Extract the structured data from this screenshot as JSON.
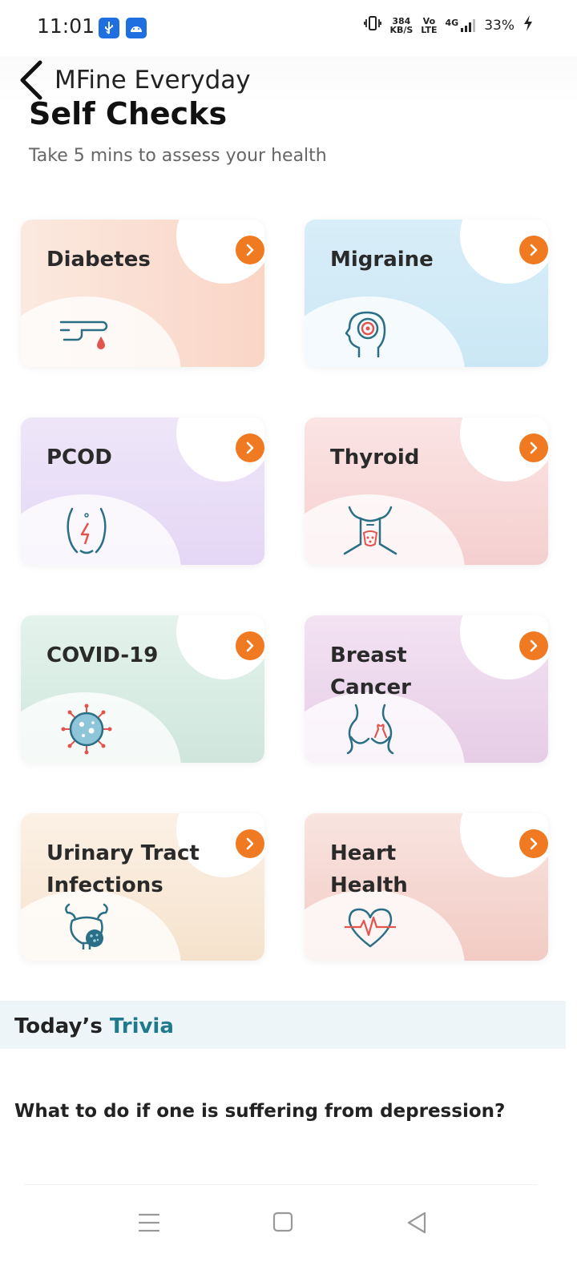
{
  "status": {
    "time": "11:01",
    "net_speed_value": "384",
    "net_speed_unit": "KB/S",
    "volte_top": "Vo",
    "volte_bottom": "LTE",
    "network": "4G",
    "battery": "33%"
  },
  "header": {
    "title": "MFine Everyday"
  },
  "page": {
    "title": "Self Checks",
    "subtitle": "Take 5 mins to assess your health"
  },
  "cards": [
    {
      "label": "Diabetes",
      "icon": "finger-blood-drop-icon"
    },
    {
      "label": "Migraine",
      "icon": "head-target-icon"
    },
    {
      "label": "PCOD",
      "icon": "abdomen-pain-icon"
    },
    {
      "label": "Thyroid",
      "icon": "neck-thyroid-icon"
    },
    {
      "label": "COVID-19",
      "icon": "virus-icon"
    },
    {
      "label": "Breast Cancer",
      "icon": "breast-ribbon-icon"
    },
    {
      "label": "Urinary Tract Infections",
      "icon": "bladder-icon"
    },
    {
      "label": "Heart Health",
      "icon": "heart-pulse-icon"
    }
  ],
  "trivia": {
    "title_prefix": "Today’s",
    "title_accent": "Trivia",
    "question": "What to do if one is suffering from depression?"
  },
  "colors": {
    "accent_orange": "#f07a22",
    "trivia_teal": "#1e7a8c",
    "icon_teal": "#2b6f86",
    "icon_red": "#e2554f"
  }
}
